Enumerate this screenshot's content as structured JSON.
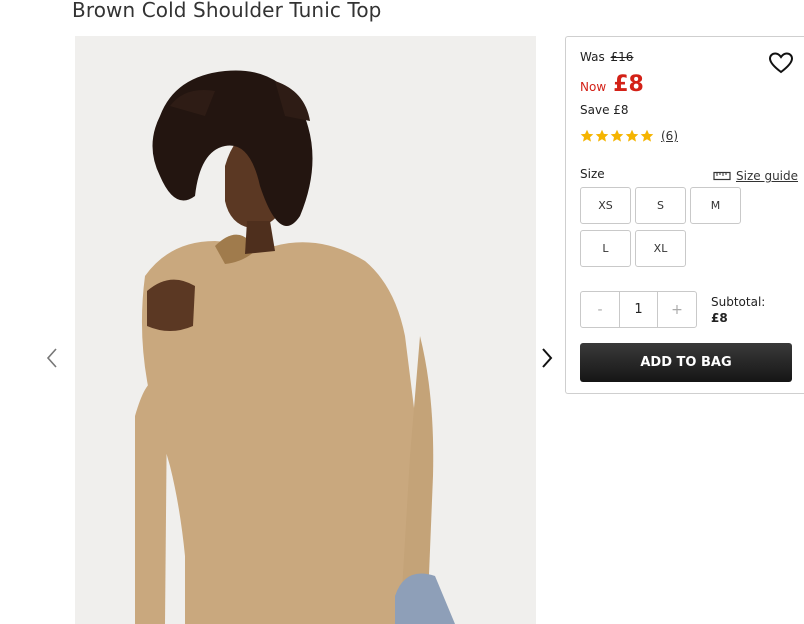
{
  "product": {
    "title": "Brown Cold Shoulder Tunic Top",
    "image_alt": "Woman wearing brown cold shoulder tunic top"
  },
  "gallery": {
    "prev_icon": "chevron-left-icon",
    "next_icon": "chevron-right-icon"
  },
  "pricing": {
    "was_label": "Was",
    "was_price": "£16",
    "now_label": "Now",
    "now_price": "£8",
    "save_label": "Save",
    "save_amount": "£8",
    "sale_color": "#d32117"
  },
  "rating": {
    "stars": 5,
    "review_count": "(6)",
    "star_color": "#f5b400"
  },
  "size": {
    "label": "Size",
    "guide_label": "Size guide",
    "options": [
      "XS",
      "S",
      "M",
      "L",
      "XL"
    ]
  },
  "quantity": {
    "minus": "-",
    "value": "1",
    "plus": "+"
  },
  "subtotal": {
    "label": "Subtotal:",
    "amount": "£8"
  },
  "cta": {
    "add_to_bag": "ADD TO BAG"
  }
}
